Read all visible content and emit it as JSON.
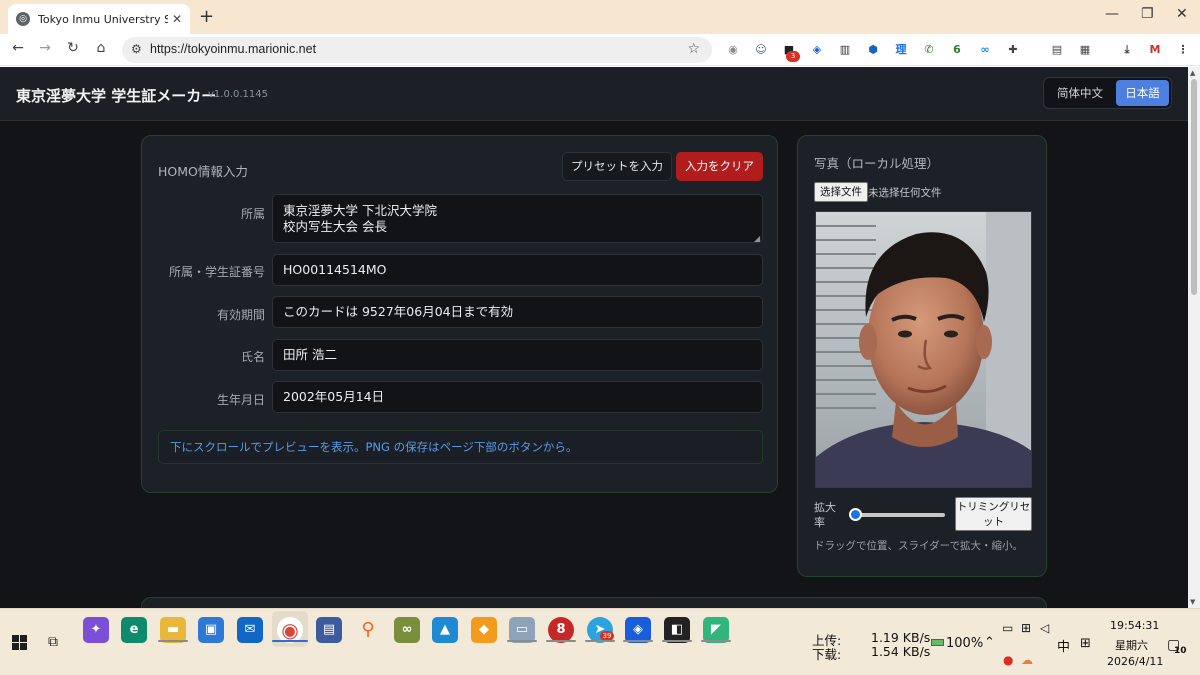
{
  "browser": {
    "tab_title": "Tokyo Inmu Universtry Stude",
    "url": "https://tokyoinmu.marionic.net",
    "extension_badge": "3",
    "extensions": [
      {
        "name": "circle-extension-icon",
        "glyph": "◉",
        "color": "#8a8a8a"
      },
      {
        "name": "ghost-extension-icon",
        "glyph": "☺",
        "color": "#4a5b8c"
      },
      {
        "name": "chat-extension-icon",
        "glyph": "■",
        "color": "#202124"
      },
      {
        "name": "bitwarden-extension-icon",
        "glyph": "◈",
        "color": "#175ddc"
      },
      {
        "name": "archive-extension-icon",
        "glyph": "▥",
        "color": "#333333"
      },
      {
        "name": "shield-extension-icon",
        "glyph": "⬢",
        "color": "#1565c0"
      },
      {
        "name": "kanji-extension-icon",
        "glyph": "理",
        "color": "#1a73e8"
      },
      {
        "name": "phone-extension-icon",
        "glyph": "✆",
        "color": "#2e7d32"
      },
      {
        "name": "six-extension-icon",
        "glyph": "6",
        "color": "#2e7d32"
      },
      {
        "name": "loop-extension-icon",
        "glyph": "∞",
        "color": "#1e88e5"
      },
      {
        "name": "puzzle-extension-icon",
        "glyph": "✚",
        "color": "#444444"
      },
      {
        "name": "reading-list-icon",
        "glyph": "▤",
        "color": "#444444"
      },
      {
        "name": "qr-code-icon",
        "glyph": "▦",
        "color": "#444444"
      },
      {
        "name": "download-icon",
        "glyph": "⤓",
        "color": "#444444"
      },
      {
        "name": "mario-extension-icon",
        "glyph": "M",
        "color": "#d32f2f"
      },
      {
        "name": "menu-icon",
        "glyph": "⋮",
        "color": "#444444"
      }
    ]
  },
  "app": {
    "title": "東京淫夢大学 学生証メーカー",
    "version": "v1.0.0.1145",
    "languages": [
      "简体中文",
      "日本語"
    ],
    "active_language": "日本語",
    "accent_color": "#4d7fe0"
  },
  "form": {
    "title": "HOMO情報入力",
    "preset_button": "プリセットを入力",
    "clear_button": "入力をクリア",
    "fields": [
      {
        "label": "所属",
        "value": "東京淫夢大学 下北沢大学院\n校内写生大会 会長"
      },
      {
        "label": "所属・学生証番号",
        "value": "HO00114514MO"
      },
      {
        "label": "有効期間",
        "value": "このカードは 9527年06月04日まで有効"
      },
      {
        "label": "氏名",
        "value": "田所 浩二"
      },
      {
        "label": "生年月日",
        "value": "2002年05月14日"
      }
    ],
    "hint": "下にスクロールでプレビューを表示。PNG の保存はページ下部のボタンから。"
  },
  "photo": {
    "title": "写真（ローカル処理）",
    "file_button": "选择文件",
    "file_status": "未选择任何文件",
    "zoom_label": "拡大率",
    "zoom_level": 0.05,
    "trim_reset_button": "トリミングリセット",
    "hint": "ドラッグで位置、スライダーで拡大・縮小。"
  },
  "taskbar": {
    "upload_label": "上传:",
    "upload_speed": "1.19 KB/s",
    "download_label": "下载:",
    "download_speed": "1.54 KB/s",
    "battery": "100%",
    "ime_language": "中",
    "time": "19:54:31",
    "weekday": "星期六",
    "date": "2026/4/11",
    "notifications": "10",
    "telegram_badge": "39"
  }
}
